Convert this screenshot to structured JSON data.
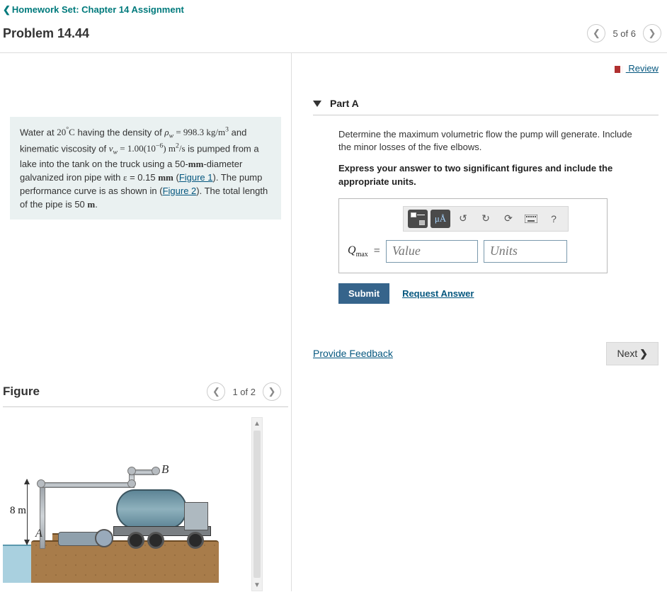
{
  "breadcrumb": {
    "label": "Homework Set: Chapter 14 Assignment"
  },
  "header": {
    "problem_title": "Problem 14.44",
    "position": "5 of 6"
  },
  "review_label": " Review",
  "problem_statement": {
    "pre": "Water at ",
    "temp": "20°C",
    "t2": " having the density of ",
    "rho": "ρ_w = 998.3 kg/m³",
    "t3": " and kinematic viscosity of ",
    "nu": "ν_w = 1.00(10⁻⁶) m²/s",
    "t4": " is pumped from a lake into the tank on the truck using a 50-",
    "mm": "mm",
    "t5": "-diameter galvanized iron pipe with ",
    "eps": "ε",
    "t6": " = 0.15 ",
    "mm2": "mm",
    "t7": " (",
    "fig1": "Figure 1",
    "t8": "). The pump performance curve is as shown in (",
    "fig2": "Figure 2",
    "t9": "). The total length of the pipe is 50 ",
    "m": "m",
    "t10": "."
  },
  "figure": {
    "title": "Figure",
    "position": "1 of 2",
    "dim_label": "8 m",
    "pointA": "A",
    "pointB": "B"
  },
  "part": {
    "label": "Part A",
    "question": "Determine the maximum volumetric flow the pump will generate. Include the minor losses of the five elbows.",
    "instruction": "Express your answer to two significant figures and include the appropriate units.",
    "var_symbol": "Q",
    "var_sub": "max",
    "equals": " = ",
    "value_placeholder": "Value",
    "units_placeholder": "Units",
    "toolbar": {
      "special": "μÅ",
      "help": "?"
    },
    "submit_label": "Submit",
    "request_answer": "Request Answer"
  },
  "footer": {
    "provide_feedback": "Provide Feedback",
    "next": "Next"
  }
}
